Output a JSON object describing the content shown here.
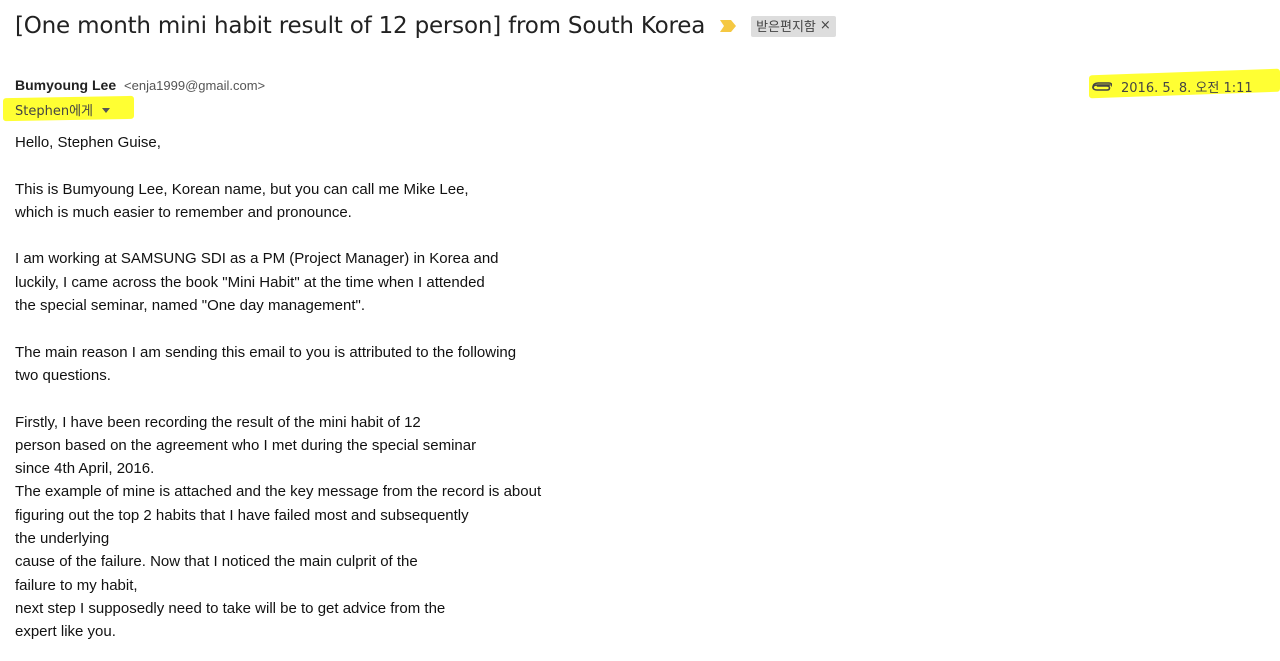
{
  "email": {
    "subject": "[One month mini habit result of 12 person] from South Korea",
    "label": "받은편지함",
    "label_remove": "×",
    "sender_name": "Bumyoung Lee",
    "sender_email": "<enja1999@gmail.com>",
    "recipient": "Stephen에게",
    "date": "2016. 5. 8. 오전 1:11",
    "icons": {
      "importance": "importance-marker-icon",
      "attachment": "paperclip-icon",
      "recipient_details": "caret-down-icon"
    },
    "colors": {
      "highlight": "#ffff33",
      "importance_marker": "#f5c842",
      "label_chip": "#dddddd"
    },
    "body_lines": [
      "Hello, Stephen Guise,",
      "",
      "This is Bumyoung Lee, Korean name, but you can call me Mike Lee,",
      "which is much easier to remember and pronounce.",
      "",
      "I am working at SAMSUNG SDI as a PM (Project Manager) in Korea and",
      "luckily, I came across the book \"Mini Habit\" at the time when I attended",
      "the special seminar, named \"One day management\".",
      "",
      "The main reason I am sending this email to you is attributed to the following",
      "two questions.",
      "",
      "Firstly, I have been recording the result of the mini habit of 12",
      "person based on the agreement who I met during the special seminar",
      "since 4th April, 2016.",
      "The example of mine is attached and the key message from the record is about",
      "figuring out the top 2 habits that I have failed most and subsequently",
      "the underlying",
      "cause of the failure. Now that I noticed the main culprit of the",
      "failure to my habit,",
      "next step I supposedly need to take will be to get advice from the",
      "expert like you."
    ]
  }
}
